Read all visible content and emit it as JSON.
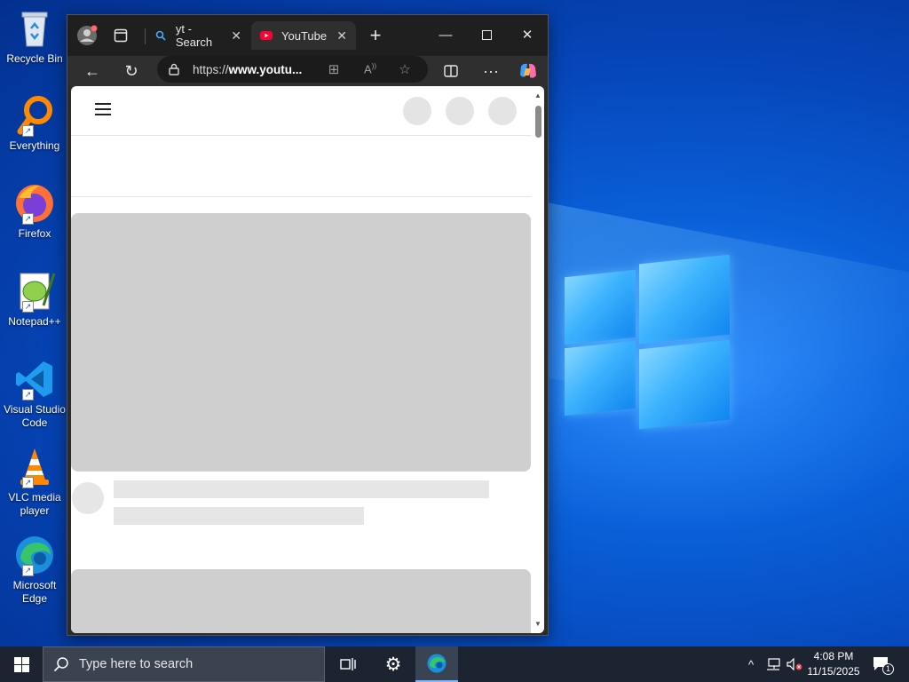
{
  "desktop": {
    "icons": [
      {
        "label": "Recycle Bin"
      },
      {
        "label": "Everything"
      },
      {
        "label": "Firefox"
      },
      {
        "label": "Notepad++"
      },
      {
        "label": "Visual Studio Code"
      },
      {
        "label": "VLC media player"
      },
      {
        "label": "Microsoft Edge"
      }
    ]
  },
  "browser": {
    "tabs": [
      {
        "title": "yt - Search",
        "icon": "bing-search-icon",
        "active": false
      },
      {
        "title": "YouTube",
        "icon": "youtube-icon",
        "active": true
      }
    ],
    "address": {
      "prefix": "https://",
      "host": "www.youtu..."
    },
    "accent": "#ff0033"
  },
  "taskbar": {
    "search_placeholder": "Type here to search",
    "time": "4:08 PM",
    "date": "11/15/2025",
    "notification_count": "1"
  }
}
